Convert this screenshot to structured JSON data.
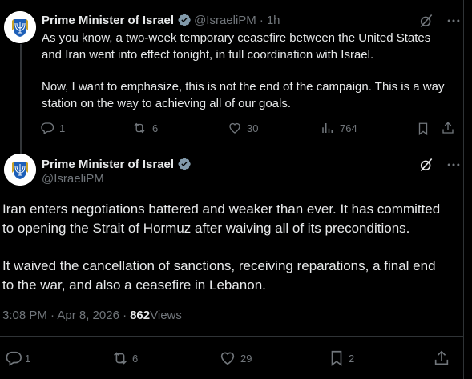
{
  "tweet1": {
    "author_name": "Prime Minister of Israel",
    "handle": "@IsraeliPM",
    "separator": "·",
    "time": "1h",
    "para1_line1": "As you know, a two-week temporary ceasefire between the United States",
    "para1_line2": "and Iran went into effect tonight, in full coordination with Israel.",
    "para2_line1": "Now, I want to emphasize, this is not the end of the campaign. This is a way",
    "para2_line2": "station on the way to achieving all of our goals.",
    "replies": "1",
    "reposts": "6",
    "likes": "30",
    "views": "764"
  },
  "tweet2": {
    "author_name": "Prime Minister of Israel",
    "handle": "@IsraeliPM",
    "para1_line1": "Iran enters negotiations battered and weaker than ever. It has committed",
    "para1_line2": "to opening the Strait of Hormuz after waiving all of its preconditions.",
    "para2_line1": "It waived the cancellation of sanctions, receiving reparations, a final end",
    "para2_line2": "to the war, and also a ceasefire in Lebanon.",
    "timestamp": "3:08 PM · Apr 8, 2026 · ",
    "views_count": "862",
    "views_label": " Views",
    "replies": "1",
    "reposts": "6",
    "likes": "29",
    "bookmarks": "2"
  },
  "colors": {
    "background": "#000000",
    "text": "#e7e9ea",
    "secondary": "#71767b",
    "verified": "#829aab",
    "divider": "#2f3336"
  },
  "icons": [
    "grok-icon",
    "more-icon",
    "reply-icon",
    "repost-icon",
    "like-icon",
    "views-icon",
    "bookmark-icon",
    "share-icon",
    "verified-badge-icon",
    "menorah-emblem-icon"
  ]
}
